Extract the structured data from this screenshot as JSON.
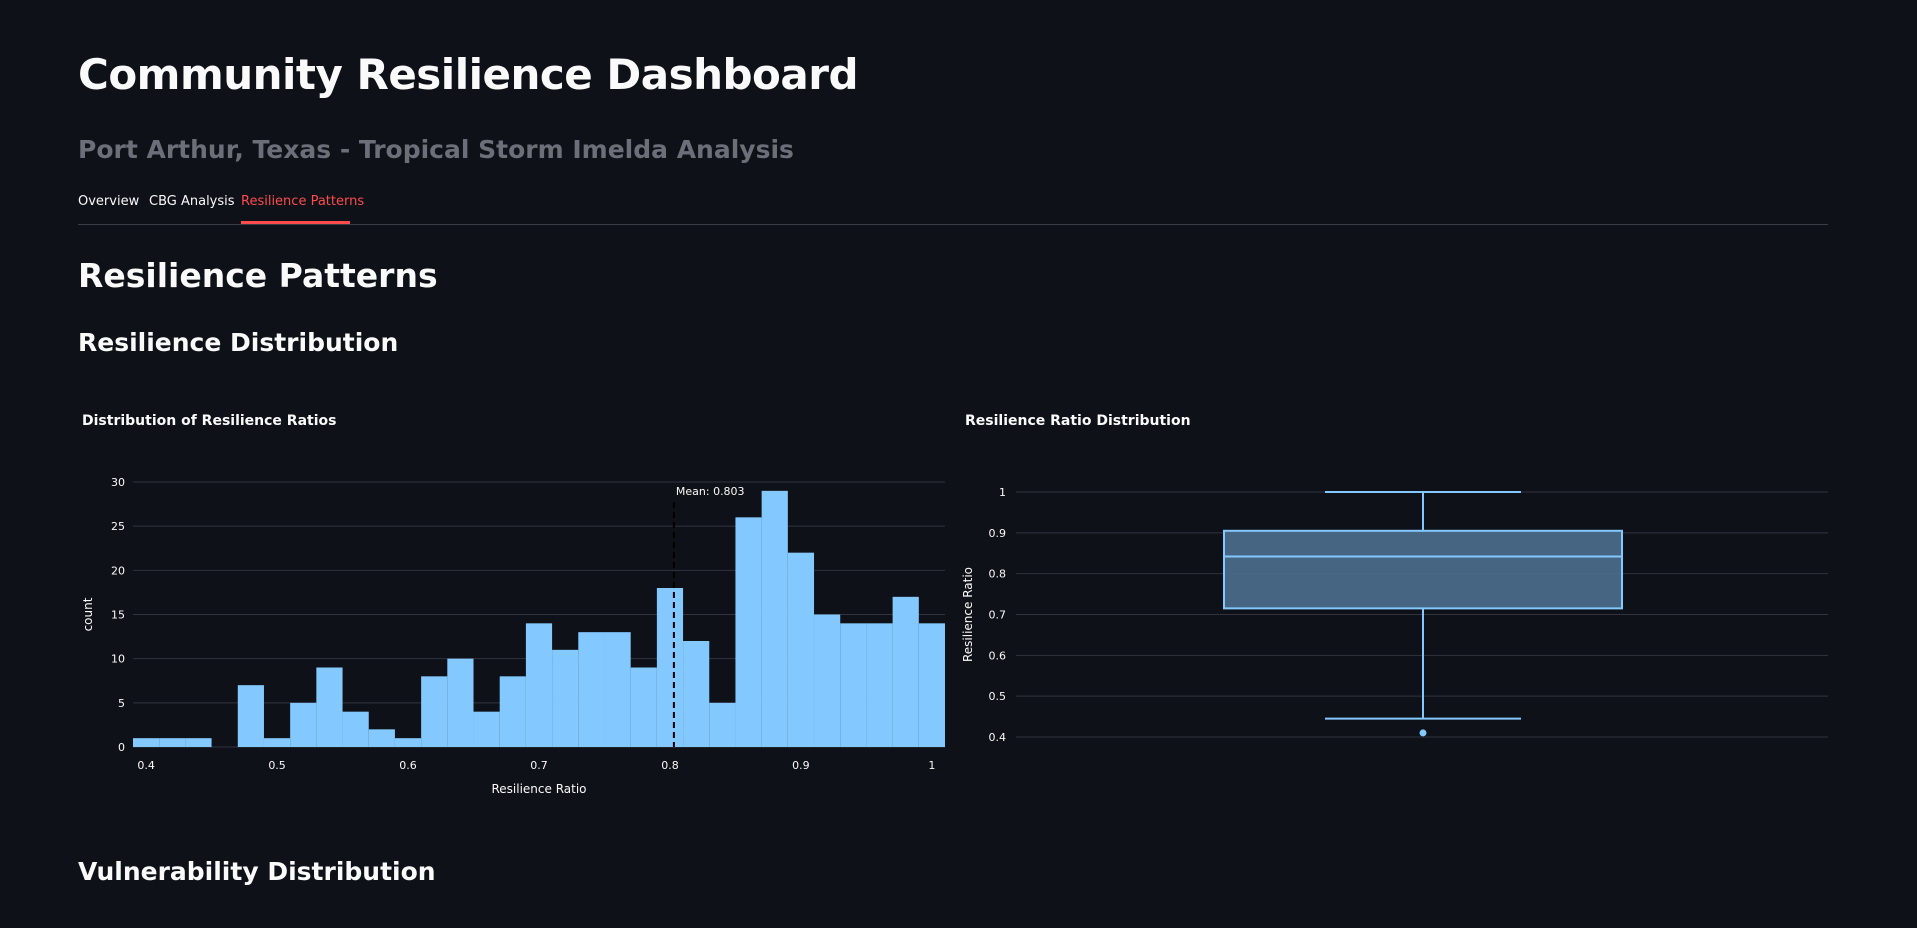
{
  "header": {
    "title": "Community Resilience Dashboard",
    "subtitle": "Port Arthur, Texas - Tropical Storm Imelda Analysis"
  },
  "tabs": [
    {
      "label": "Overview",
      "active": false
    },
    {
      "label": "CBG Analysis",
      "active": false
    },
    {
      "label": "Resilience Patterns",
      "active": true
    }
  ],
  "section": {
    "title": "Resilience Patterns",
    "subsections": [
      "Resilience Distribution",
      "Vulnerability Distribution"
    ]
  },
  "colors": {
    "background": "#0e1117",
    "accent": "#ff4b4b",
    "bars": "#83c9ff",
    "box_fill": "#4a6a88",
    "box_line": "#83c9ff"
  },
  "chart_data": [
    {
      "type": "bar",
      "title": "Distribution of Resilience Ratios",
      "xlabel": "Resilience Ratio",
      "ylabel": "count",
      "xlim": [
        0.39,
        1.01
      ],
      "ylim": [
        0,
        30
      ],
      "xticks": [
        "0.4",
        "0.5",
        "0.6",
        "0.7",
        "0.8",
        "0.9",
        "1"
      ],
      "yticks": [
        "0",
        "5",
        "10",
        "15",
        "20",
        "25",
        "30"
      ],
      "bin_width": 0.02,
      "bin_starts": [
        0.39,
        0.41,
        0.43,
        0.45,
        0.47,
        0.49,
        0.51,
        0.53,
        0.55,
        0.57,
        0.59,
        0.61,
        0.63,
        0.65,
        0.67,
        0.69,
        0.71,
        0.73,
        0.75,
        0.77,
        0.79,
        0.81,
        0.83,
        0.85,
        0.87,
        0.89,
        0.91,
        0.93,
        0.95,
        0.97,
        0.99
      ],
      "values": [
        1,
        1,
        1,
        0,
        7,
        1,
        5,
        9,
        4,
        2,
        1,
        8,
        10,
        4,
        8,
        14,
        11,
        13,
        13,
        9,
        18,
        12,
        5,
        26,
        29,
        22,
        15,
        14,
        14,
        17,
        14
      ],
      "mean_value": 0.803,
      "mean_label": "Mean: 0.803",
      "grid": true
    },
    {
      "type": "box",
      "title": "Resilience Ratio Distribution",
      "ylabel": "Resilience Ratio",
      "ylim": [
        0.4,
        1.0
      ],
      "yticks": [
        "0.4",
        "0.5",
        "0.6",
        "0.7",
        "0.8",
        "0.9",
        "1"
      ],
      "min": 0.445,
      "q1": 0.715,
      "median": 0.842,
      "q3": 0.905,
      "max": 1.0,
      "outliers": [
        0.41
      ],
      "grid": true
    }
  ]
}
